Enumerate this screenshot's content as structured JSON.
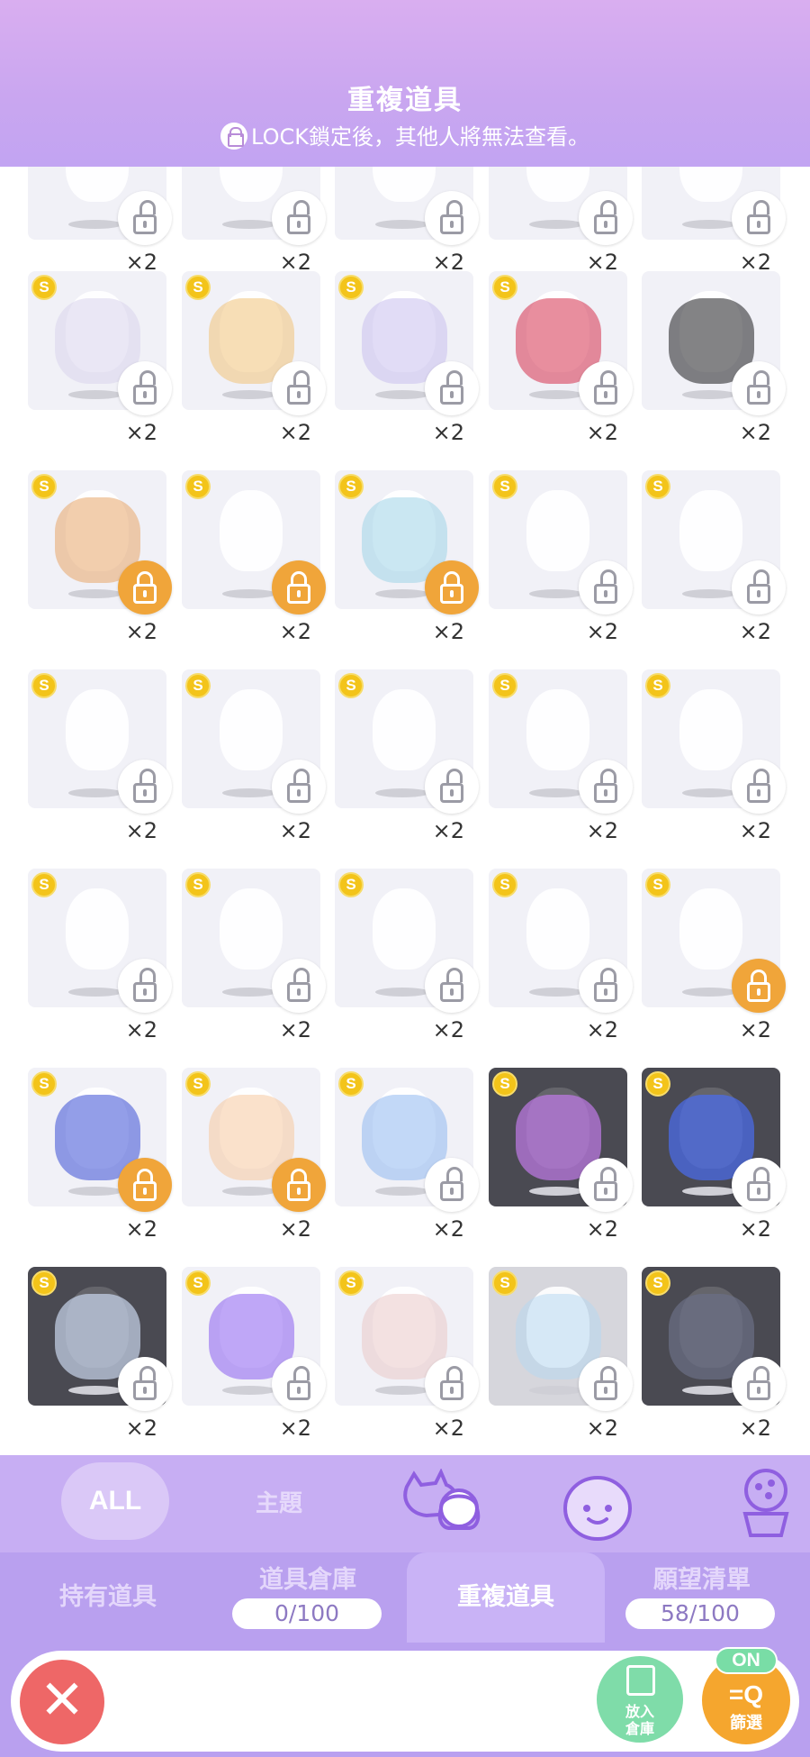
{
  "header": {
    "title": "重複道具",
    "subtitle": "LOCK鎖定後，其他人將無法查看。"
  },
  "items": [
    {
      "row": 0,
      "col": 0,
      "qty": "×2",
      "lock": "off",
      "coin": false,
      "bg": "light"
    },
    {
      "row": 0,
      "col": 1,
      "qty": "×2",
      "lock": "off",
      "coin": false,
      "bg": "light"
    },
    {
      "row": 0,
      "col": 2,
      "qty": "×2",
      "lock": "off",
      "coin": false,
      "bg": "light"
    },
    {
      "row": 0,
      "col": 3,
      "qty": "×2",
      "lock": "off",
      "coin": false,
      "bg": "light"
    },
    {
      "row": 0,
      "col": 4,
      "qty": "×2",
      "lock": "off",
      "coin": false,
      "bg": "light"
    },
    {
      "row": 1,
      "col": 0,
      "qty": "×2",
      "lock": "off",
      "coin": true,
      "bg": "light",
      "art": "#d9d3ec"
    },
    {
      "row": 1,
      "col": 1,
      "qty": "×2",
      "lock": "off",
      "coin": true,
      "bg": "light",
      "art": "#f0c37a"
    },
    {
      "row": 1,
      "col": 2,
      "qty": "×2",
      "lock": "off",
      "coin": true,
      "bg": "light",
      "art": "#c9c0ef"
    },
    {
      "row": 1,
      "col": 3,
      "qty": "×2",
      "lock": "off",
      "coin": true,
      "bg": "light",
      "art": "#d6324f"
    },
    {
      "row": 1,
      "col": 4,
      "qty": "×2",
      "lock": "off",
      "coin": false,
      "bg": "light",
      "art": "#1d1d21"
    },
    {
      "row": 2,
      "col": 0,
      "qty": "×2",
      "lock": "on",
      "coin": true,
      "bg": "light",
      "art": "#e8a66a"
    },
    {
      "row": 2,
      "col": 1,
      "qty": "×2",
      "lock": "on",
      "coin": true,
      "bg": "light"
    },
    {
      "row": 2,
      "col": 2,
      "qty": "×2",
      "lock": "on",
      "coin": true,
      "bg": "light",
      "art": "#9fd4e8"
    },
    {
      "row": 2,
      "col": 3,
      "qty": "×2",
      "lock": "off",
      "coin": true,
      "bg": "light"
    },
    {
      "row": 2,
      "col": 4,
      "qty": "×2",
      "lock": "off",
      "coin": true,
      "bg": "light"
    },
    {
      "row": 3,
      "col": 0,
      "qty": "×2",
      "lock": "off",
      "coin": true,
      "bg": "light"
    },
    {
      "row": 3,
      "col": 1,
      "qty": "×2",
      "lock": "off",
      "coin": true,
      "bg": "light"
    },
    {
      "row": 3,
      "col": 2,
      "qty": "×2",
      "lock": "off",
      "coin": true,
      "bg": "light"
    },
    {
      "row": 3,
      "col": 3,
      "qty": "×2",
      "lock": "off",
      "coin": true,
      "bg": "light"
    },
    {
      "row": 3,
      "col": 4,
      "qty": "×2",
      "lock": "off",
      "coin": true,
      "bg": "light"
    },
    {
      "row": 4,
      "col": 0,
      "qty": "×2",
      "lock": "off",
      "coin": true,
      "bg": "light"
    },
    {
      "row": 4,
      "col": 1,
      "qty": "×2",
      "lock": "off",
      "coin": true,
      "bg": "light"
    },
    {
      "row": 4,
      "col": 2,
      "qty": "×2",
      "lock": "off",
      "coin": true,
      "bg": "light"
    },
    {
      "row": 4,
      "col": 3,
      "qty": "×2",
      "lock": "off",
      "coin": true,
      "bg": "light"
    },
    {
      "row": 4,
      "col": 4,
      "qty": "×2",
      "lock": "on",
      "coin": true,
      "bg": "light"
    },
    {
      "row": 5,
      "col": 0,
      "qty": "×2",
      "lock": "on",
      "coin": true,
      "bg": "light",
      "art": "#3b4fd6"
    },
    {
      "row": 5,
      "col": 1,
      "qty": "×2",
      "lock": "on",
      "coin": true,
      "bg": "light",
      "art": "#f5c9a0"
    },
    {
      "row": 5,
      "col": 2,
      "qty": "×2",
      "lock": "off",
      "coin": true,
      "bg": "light",
      "art": "#8fb8f0"
    },
    {
      "row": 5,
      "col": 3,
      "qty": "×2",
      "lock": "off",
      "coin": true,
      "bg": "dark",
      "art": "#c07ae8"
    },
    {
      "row": 5,
      "col": 4,
      "qty": "×2",
      "lock": "off",
      "coin": true,
      "bg": "dark",
      "art": "#4a6cf0"
    },
    {
      "row": 6,
      "col": 0,
      "qty": "×2",
      "lock": "off",
      "coin": true,
      "bg": "dark",
      "art": "#c9d6ec"
    },
    {
      "row": 6,
      "col": 1,
      "qty": "×2",
      "lock": "off",
      "coin": true,
      "bg": "light",
      "art": "#8a5ef0"
    },
    {
      "row": 6,
      "col": 2,
      "qty": "×2",
      "lock": "off",
      "coin": true,
      "bg": "light",
      "art": "#e9c9c9"
    },
    {
      "row": 6,
      "col": 3,
      "qty": "×2",
      "lock": "off",
      "coin": true,
      "bg": "mid",
      "art": "#b8d8f0"
    },
    {
      "row": 6,
      "col": 4,
      "qty": "×2",
      "lock": "off",
      "coin": true,
      "bg": "dark",
      "art": "#6b6f86"
    }
  ],
  "categories": {
    "all": "ALL",
    "theme": "主題"
  },
  "tabs": {
    "owned": "持有道具",
    "storage": "道具倉庫",
    "storage_count": "0/100",
    "duplicate": "重複道具",
    "wishlist": "願望清單",
    "wishlist_count": "58/100"
  },
  "bottom": {
    "close_symbol": "✕",
    "storage_button_line1": "放入",
    "storage_button_line2": "倉庫",
    "filter_on": "ON",
    "filter_glyph": "=Q",
    "filter_label": "篩選"
  },
  "colors": {
    "header": "#c9a6f0",
    "lock_on": "#f0a53a",
    "coin": "#f3c41a",
    "close": "#ee6767",
    "storage_btn": "#7fdca9",
    "filter_btn": "#f5a62e"
  }
}
